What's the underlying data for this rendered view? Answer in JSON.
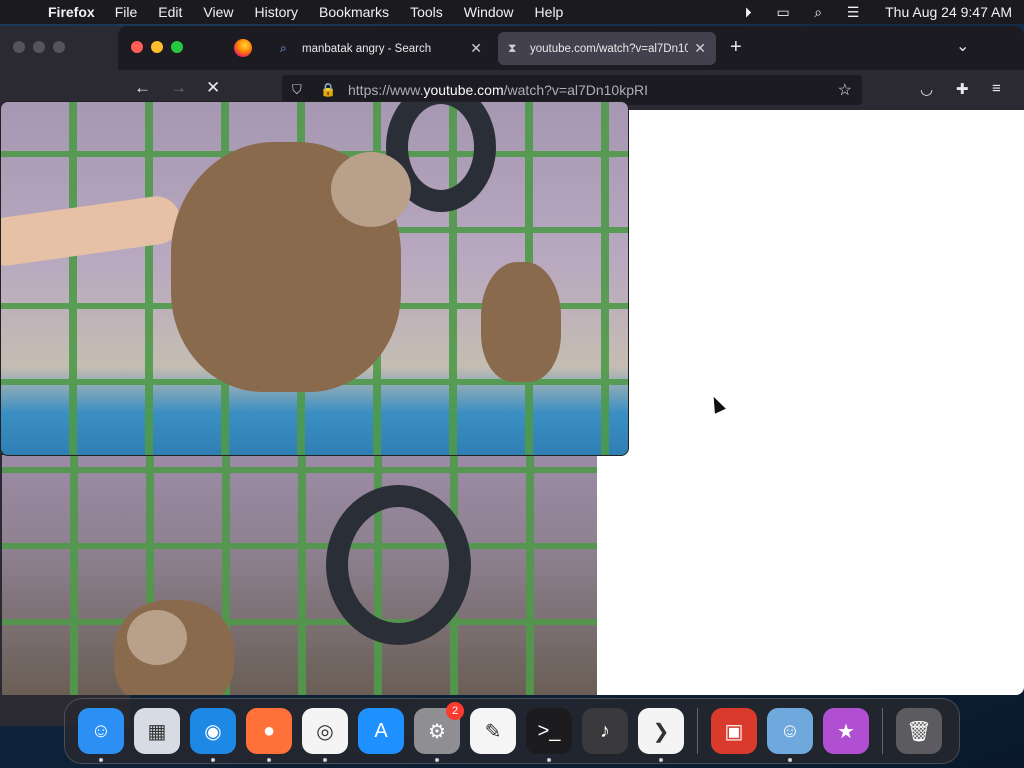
{
  "menubar": {
    "app_name": "Firefox",
    "items": [
      "File",
      "Edit",
      "View",
      "History",
      "Bookmarks",
      "Tools",
      "Window",
      "Help"
    ],
    "clock": "Thu Aug 24  9:47 AM"
  },
  "browser": {
    "tabs": [
      {
        "title": "manbatak angry - Search",
        "icon": "search-icon",
        "active": false
      },
      {
        "title": "youtube.com/watch?v=al7Dn10kpRI",
        "icon": "hourglass-icon",
        "active": true
      }
    ],
    "url": {
      "prefix": "https://www.",
      "host": "youtube.com",
      "path": "/watch?v=al7Dn10kpRI"
    }
  },
  "dock": {
    "apps": [
      {
        "name": "Finder",
        "icon": "finder-icon",
        "color": "#2c8ff4",
        "glyph": "☺"
      },
      {
        "name": "Launchpad",
        "icon": "launchpad-icon",
        "color": "#d7dbe3",
        "glyph": "▦"
      },
      {
        "name": "Safari",
        "icon": "safari-icon",
        "color": "#1e88e5",
        "glyph": "◉"
      },
      {
        "name": "Firefox",
        "icon": "firefox-icon",
        "color": "#ff7139",
        "glyph": "●"
      },
      {
        "name": "Chrome",
        "icon": "chrome-icon",
        "color": "#f4f4f4",
        "glyph": "◎"
      },
      {
        "name": "App Store",
        "icon": "app-store-icon",
        "color": "#1e90ff",
        "glyph": "A"
      },
      {
        "name": "System Settings",
        "icon": "settings-icon",
        "color": "#8e8e93",
        "glyph": "⚙",
        "badge": "2"
      },
      {
        "name": "TextEdit",
        "icon": "textedit-icon",
        "color": "#f5f5f5",
        "glyph": "✎"
      },
      {
        "name": "Terminal",
        "icon": "terminal-icon",
        "color": "#1c1c1e",
        "glyph": ">_"
      },
      {
        "name": "GarageBand",
        "icon": "garageband-icon",
        "color": "#3a3a3c",
        "glyph": "♪"
      },
      {
        "name": "VS Code",
        "icon": "vscode-icon",
        "color": "#f4f4f4",
        "glyph": "❯"
      },
      {
        "name": "Photo Booth",
        "icon": "photo-booth-icon",
        "color": "#d93a2b",
        "glyph": "▣"
      },
      {
        "name": "Finder Recent",
        "icon": "finder-recent-icon",
        "color": "#6fa8dc",
        "glyph": "☺"
      },
      {
        "name": "Game",
        "icon": "game-icon",
        "color": "#b04fd1",
        "glyph": "★"
      }
    ],
    "trash": {
      "name": "Trash",
      "icon": "trash-icon"
    }
  }
}
